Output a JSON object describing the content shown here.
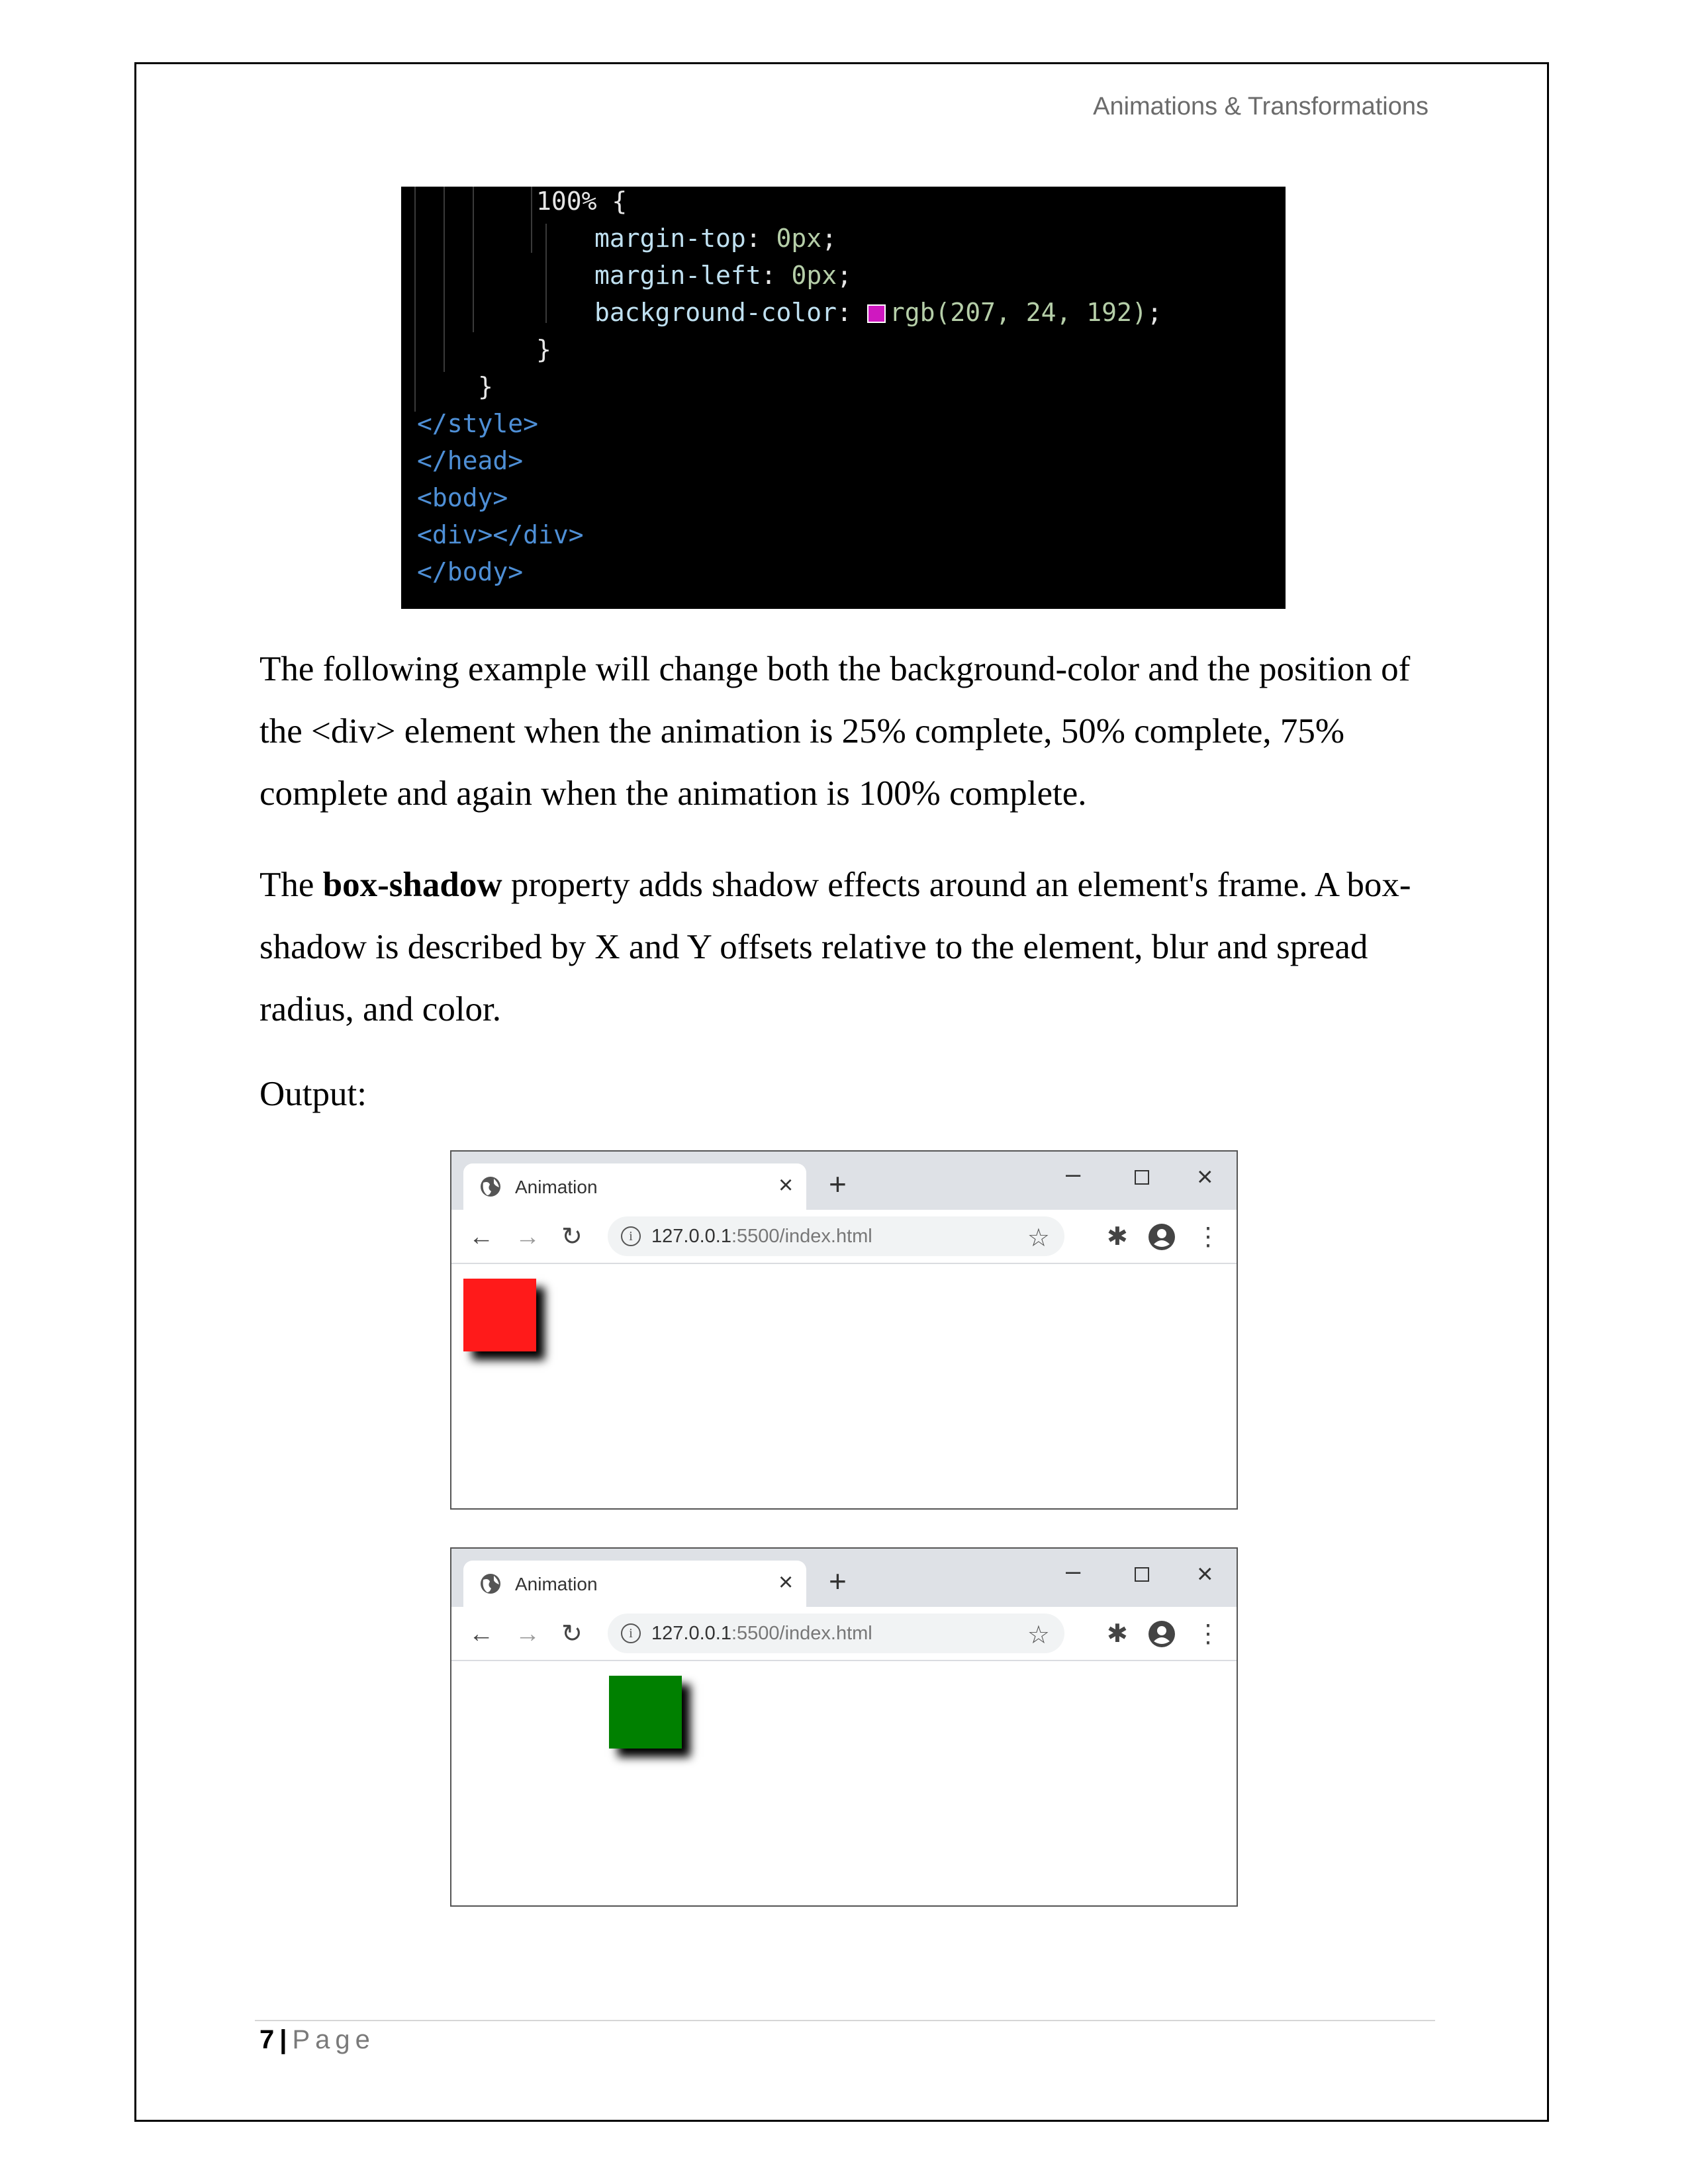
{
  "header": {
    "running_title": "Animations & Transformations"
  },
  "code": {
    "keyframe": "100%",
    "open_brace": "{",
    "prop1": "margin-top",
    "val1": "0px",
    "prop2": "margin-left",
    "val2": "0px",
    "prop3": "background-color",
    "val3": "rgb(207, 24, 192)",
    "swatch_color": "#cf18c0",
    "close_brace": "}",
    "style_close": "</style>",
    "head_close": "</head>",
    "body_open": "<body>",
    "div_tag": "<div></div>",
    "body_close": "</body>"
  },
  "paragraphs": {
    "p1": "The following example will change both the background-color and the position of the <div> element when the animation is 25% complete, 50% complete, 75% complete and again when the animation is 100% complete.",
    "p2_prefix": "The ",
    "p2_bold": "box-shadow",
    "p2_rest": " property adds shadow effects around an element's frame. A box-shadow is described by X and Y offsets relative to the element, blur and spread radius, and color.",
    "output_label": "Output:"
  },
  "browsers": [
    {
      "tab_title": "Animation",
      "url_host": "127.0.0.1",
      "url_rest": ":5500/index.html",
      "box_color": "#ff1a1a"
    },
    {
      "tab_title": "Animation",
      "url_host": "127.0.0.1",
      "url_rest": ":5500/index.html",
      "box_color": "#008000"
    }
  ],
  "footer": {
    "page_number": "7",
    "separator": "|",
    "page_label": "Page"
  }
}
